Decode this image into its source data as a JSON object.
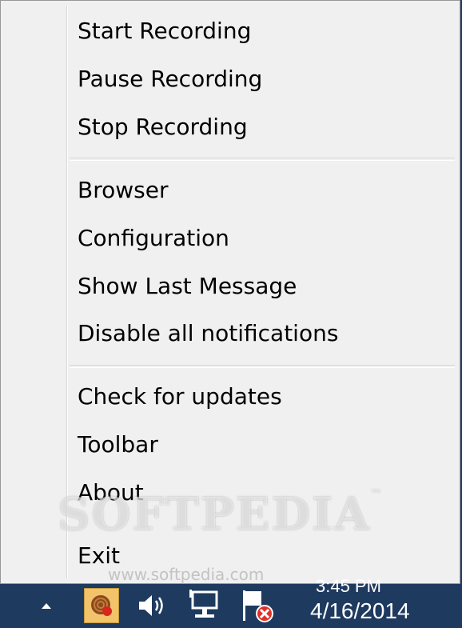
{
  "menu": {
    "group1": [
      "Start Recording",
      "Pause Recording",
      "Stop Recording"
    ],
    "group2": [
      "Browser",
      "Configuration",
      "Show Last Message",
      "Disable all notifications"
    ],
    "group3": [
      "Check for updates",
      "Toolbar",
      "About",
      "Exit"
    ]
  },
  "watermark": {
    "brand": "SOFTPEDIA",
    "tm": "™",
    "url": "www.softpedia.com"
  },
  "taskbar": {
    "time": "3:45 PM",
    "date": "4/16/2014",
    "icons": [
      "show-hidden-icons-arrow",
      "recorder-app-icon",
      "volume-icon",
      "network-icon",
      "action-center-flag-icon"
    ]
  }
}
